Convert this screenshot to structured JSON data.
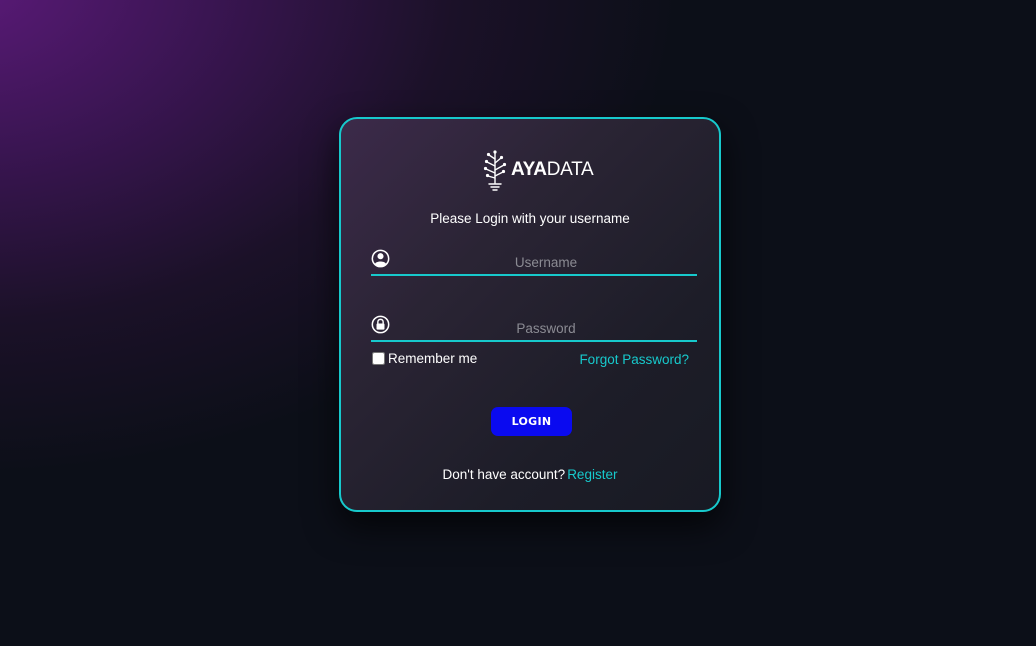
{
  "brand": {
    "logo_bold": "AYA",
    "logo_light": "DATA",
    "accent_color": "#17c9cc",
    "button_color": "#0a0af0"
  },
  "form": {
    "subtitle": "Please Login with your username",
    "username": {
      "placeholder": "Username",
      "value": "",
      "icon": "user-circle-icon"
    },
    "password": {
      "placeholder": "Password",
      "value": "",
      "icon": "lock-circle-icon"
    },
    "remember_label": "Remember me",
    "remember_checked": false,
    "forgot_label": "Forgot Password?",
    "login_label": "LOGIN",
    "register_prompt": "Don't have account?",
    "register_label": "Register"
  }
}
